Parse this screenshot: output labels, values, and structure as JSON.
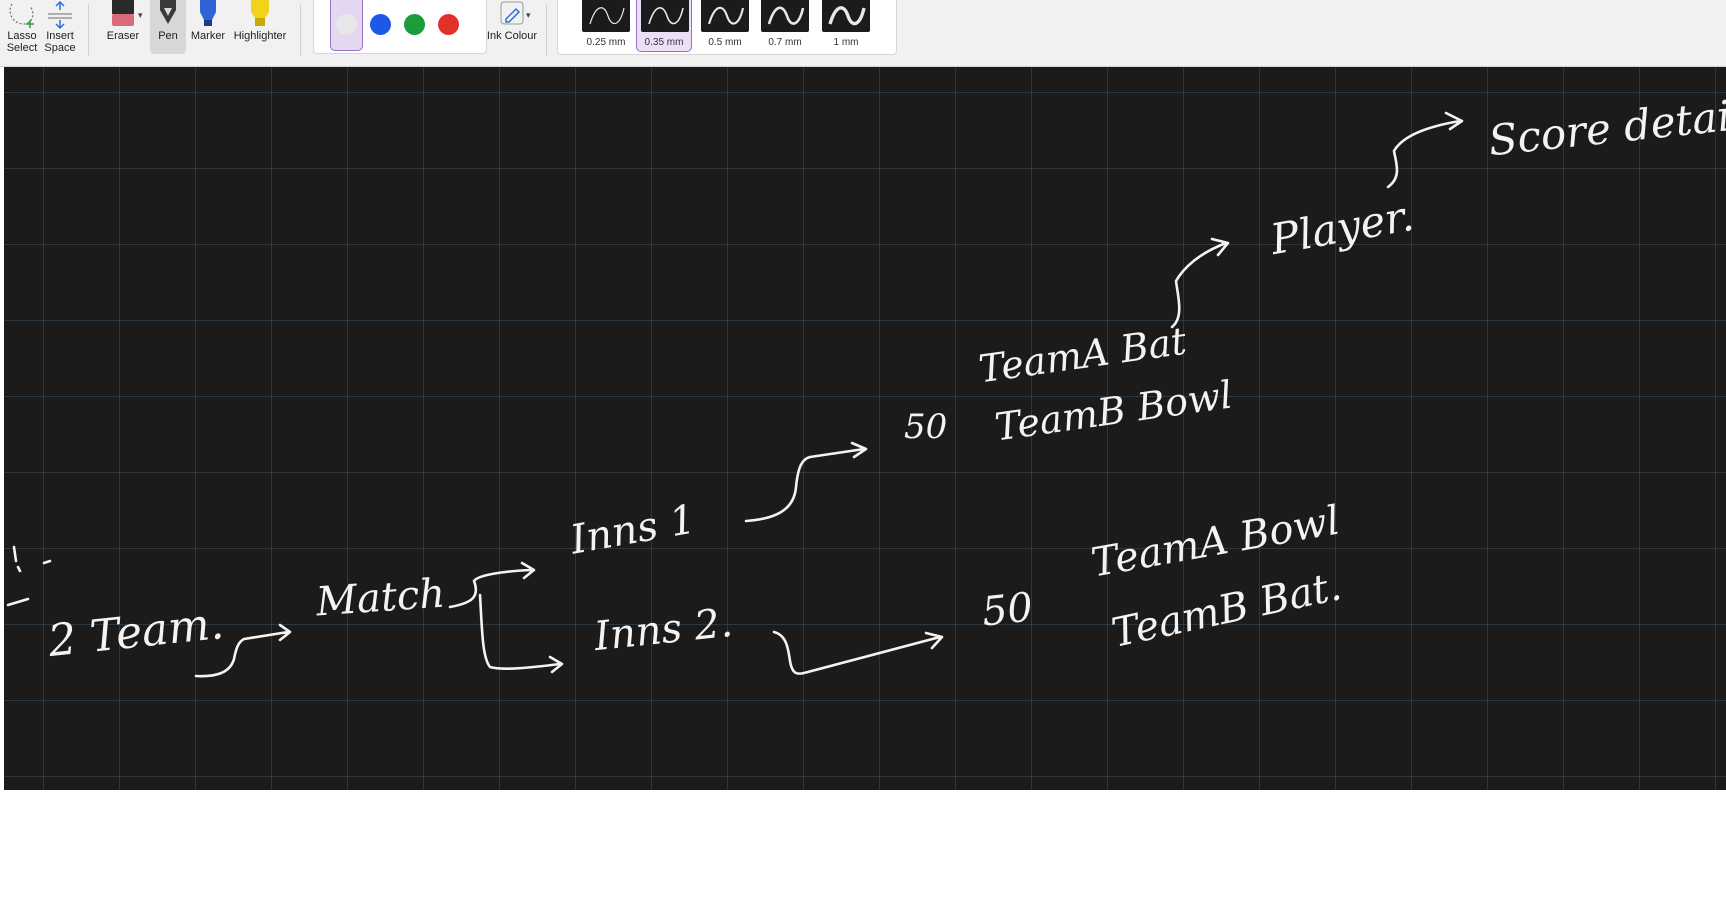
{
  "toolbar": {
    "lasso_label": "Lasso Select",
    "insert_label": "Insert Space",
    "eraser_label": "Eraser",
    "pen_label": "Pen",
    "marker_label": "Marker",
    "highlighter_label": "Highlighter",
    "ink_colour_label": "Ink Colour",
    "colors": [
      "#e7e7e7",
      "#1f57e6",
      "#1e9b3a",
      "#e23128"
    ],
    "selected_color_index": 0,
    "thickness": [
      {
        "label": "0.25 mm"
      },
      {
        "label": "0.35 mm"
      },
      {
        "label": "0.5 mm"
      },
      {
        "label": "0.7 mm"
      },
      {
        "label": "1 mm"
      }
    ],
    "selected_thickness_index": 1
  },
  "canvas": {
    "background": "#1b1b1b",
    "ink_color": "#f3f3f3",
    "notes": {
      "teams": "2 Team.",
      "match": "Match",
      "innings1": "Inns 1",
      "innings2": "Inns 2.",
      "overs1": "50",
      "overs2": "50",
      "team_a_bat": "TeamA Bat",
      "team_b_bowl": "TeamB Bowl",
      "team_a_bowl": "TeamA Bowl",
      "team_b_bat": "TeamB Bat.",
      "player": "Player.",
      "score_detail": "Score detail"
    }
  }
}
